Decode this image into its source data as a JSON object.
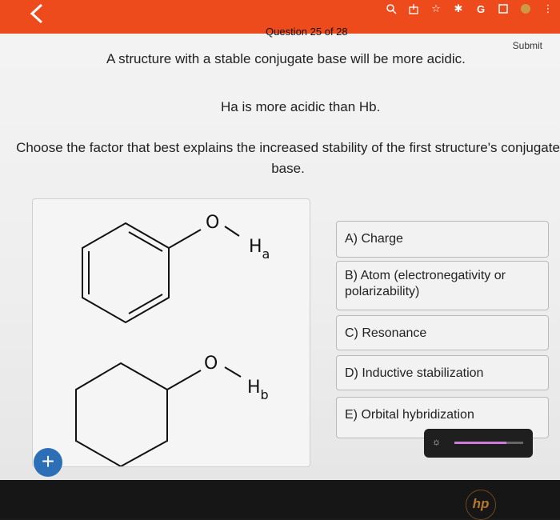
{
  "nav": {
    "back_icon": "chevron-left-icon"
  },
  "system_icons": [
    "search-icon",
    "share-icon",
    "star-icon",
    "extension-icon",
    "g-icon",
    "window-icon",
    "profile-icon",
    "menu-icon"
  ],
  "header": {
    "question_count": "Question 25 of 28",
    "submit_label": "Submit"
  },
  "prompt": {
    "line1": "A structure with a stable conjugate base will be more acidic.",
    "line2": "Ha is more acidic than Hb.",
    "line3": "Choose the factor that best explains the increased stability of the first structure's conjugate base."
  },
  "molecules": {
    "top": {
      "oxygen": "O",
      "h": "H",
      "sub": "a"
    },
    "bottom": {
      "oxygen": "O",
      "h": "H",
      "sub": "b"
    }
  },
  "options": [
    {
      "label": "A) Charge"
    },
    {
      "label": "B) Atom (electronegativity or polarizability)"
    },
    {
      "label": "C) Resonance"
    },
    {
      "label": "D) Inductive stabilization"
    },
    {
      "label": "E) Orbital hybridization"
    }
  ],
  "zoom_button": {
    "label": "+"
  },
  "brightness": {
    "level_percent": 75,
    "accent": "#cf7bd9"
  },
  "colors": {
    "header_bg": "#ee4b1d",
    "plus_bg": "#2c6fb6"
  },
  "brand": {
    "logo": "hp"
  }
}
